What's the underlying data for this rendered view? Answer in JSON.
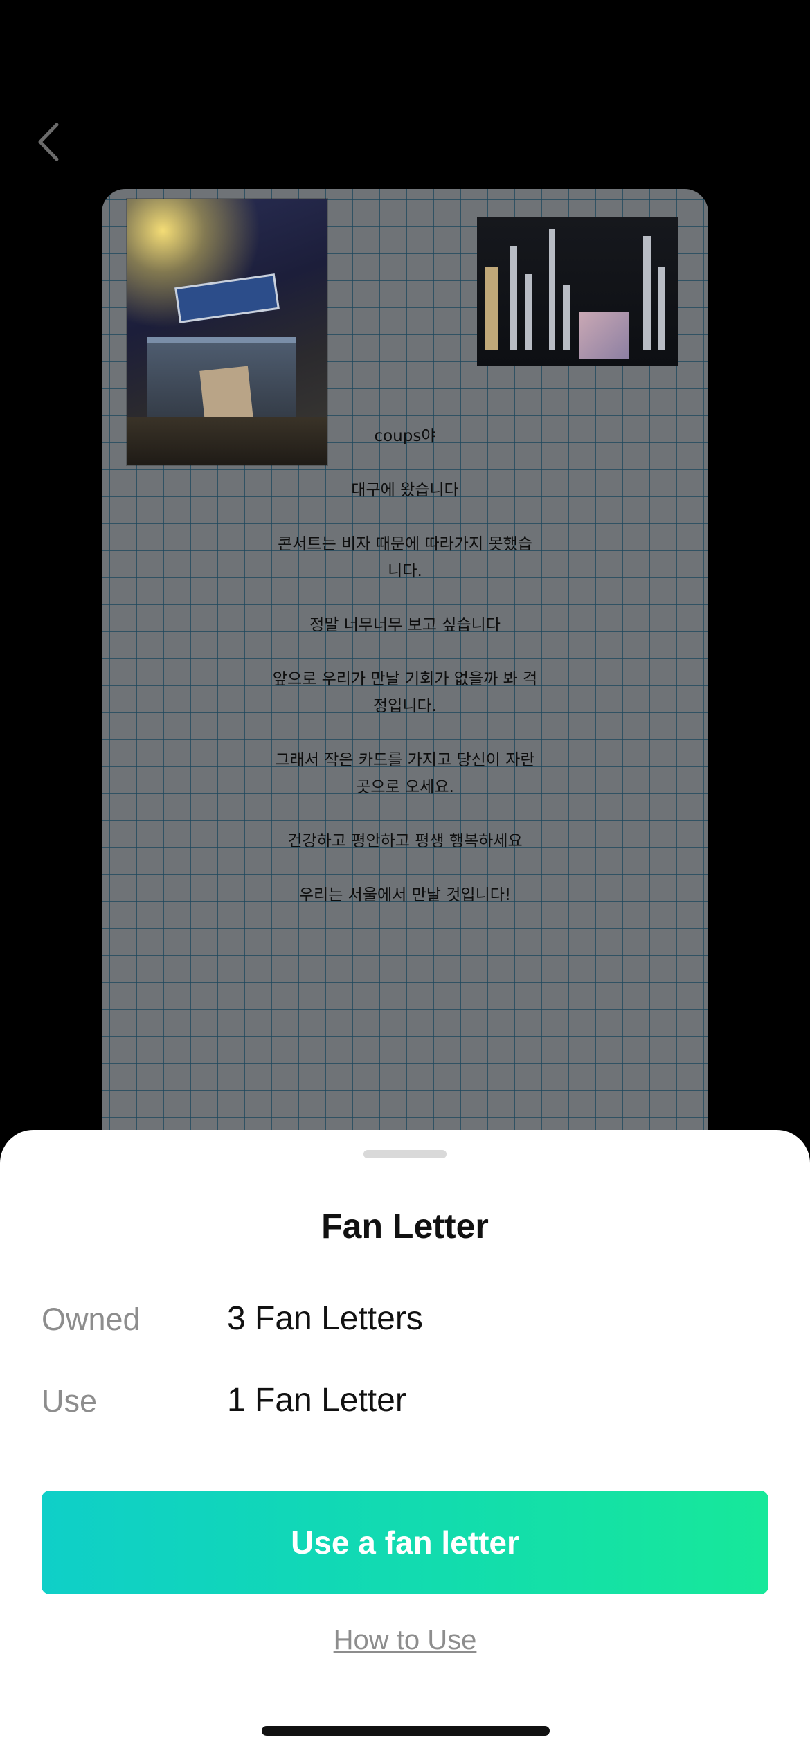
{
  "nav": {
    "back_icon": "chevron-left-icon"
  },
  "letter": {
    "lines": [
      "coups야",
      "대구에 왔습니다",
      "콘서트는 비자 때문에 따라가지 못했습\n니다.",
      "정말 너무너무 보고 싶습니다",
      "앞으로 우리가 만날 기회가 없을까 봐 걱\n정입니다.",
      "그래서 작은 카드를 가지고 당신이 자란\n곳으로 오세요.",
      "건강하고 평안하고 평생 행복하세요",
      "우리는 서울에서 만날 것입니다!"
    ]
  },
  "sheet": {
    "title": "Fan Letter",
    "owned_label": "Owned",
    "owned_value": "3 Fan Letters",
    "use_label": "Use",
    "use_value": "1 Fan Letter",
    "cta_label": "Use a fan letter",
    "howto_label": "How to Use"
  },
  "colors": {
    "cta_gradient_start": "#0fcfc8",
    "cta_gradient_end": "#17e89a",
    "label_gray": "#8d8d8d"
  }
}
